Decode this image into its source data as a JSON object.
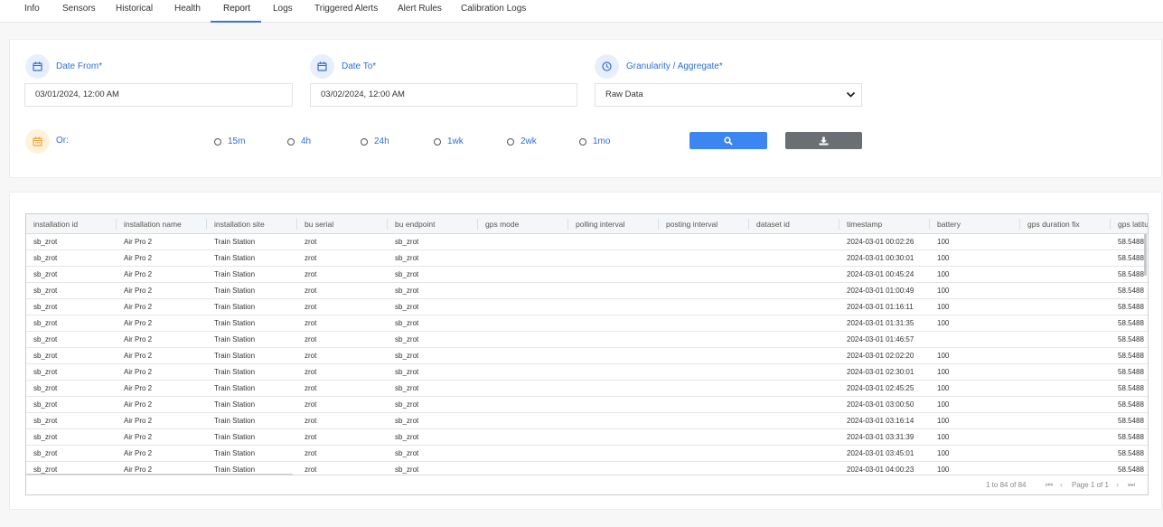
{
  "tabs": [
    "Info",
    "Sensors",
    "Historical",
    "Health",
    "Report",
    "Logs",
    "Triggered Alerts",
    "Alert Rules",
    "Calibration Logs"
  ],
  "active_tab": "Report",
  "filters": {
    "date_from_label": "Date From*",
    "date_from_value": "03/01/2024, 12:00 AM",
    "date_to_label": "Date To*",
    "date_to_value": "03/02/2024, 12:00 AM",
    "granularity_label": "Granularity / Aggregate*",
    "granularity_value": "Raw Data",
    "or_label": "Or:",
    "quick_ranges": [
      "15m",
      "4h",
      "24h",
      "1wk",
      "2wk",
      "1mo"
    ]
  },
  "icons": {
    "date_from": "calendar-icon",
    "date_to": "calendar-icon",
    "granularity": "clock-icon",
    "or": "calendar-icon",
    "search": "search-icon",
    "download": "download-icon"
  },
  "colors": {
    "accent": "#3b86f0",
    "link": "#2f6fd6",
    "gray_button": "#6b6f73",
    "or_icon_bg": "#fff2db"
  },
  "table": {
    "columns": [
      "installation id",
      "installation name",
      "installation site",
      "bu serial",
      "bu endpoint",
      "gps mode",
      "polling interval",
      "posting interval",
      "dataset id",
      "timestamp",
      "battery",
      "gps duration fix",
      "gps latitu"
    ],
    "rows": [
      [
        "sb_zrot",
        "Air Pro 2",
        "Train Station",
        "zrot",
        "sb_zrot",
        "",
        "",
        "",
        "",
        "2024-03-01 00:02:26",
        "100",
        "",
        "58.5488"
      ],
      [
        "sb_zrot",
        "Air Pro 2",
        "Train Station",
        "zrot",
        "sb_zrot",
        "",
        "",
        "",
        "",
        "2024-03-01 00:30:01",
        "100",
        "",
        "58.5488"
      ],
      [
        "sb_zrot",
        "Air Pro 2",
        "Train Station",
        "zrot",
        "sb_zrot",
        "",
        "",
        "",
        "",
        "2024-03-01 00:45:24",
        "100",
        "",
        "58.5488"
      ],
      [
        "sb_zrot",
        "Air Pro 2",
        "Train Station",
        "zrot",
        "sb_zrot",
        "",
        "",
        "",
        "",
        "2024-03-01 01:00:49",
        "100",
        "",
        "58.5488"
      ],
      [
        "sb_zrot",
        "Air Pro 2",
        "Train Station",
        "zrot",
        "sb_zrot",
        "",
        "",
        "",
        "",
        "2024-03-01 01:16:11",
        "100",
        "",
        "58.5488"
      ],
      [
        "sb_zrot",
        "Air Pro 2",
        "Train Station",
        "zrot",
        "sb_zrot",
        "",
        "",
        "",
        "",
        "2024-03-01 01:31:35",
        "100",
        "",
        "58.5488"
      ],
      [
        "sb_zrot",
        "Air Pro 2",
        "Train Station",
        "zrot",
        "sb_zrot",
        "",
        "",
        "",
        "",
        "2024-03-01 01:46:57",
        "",
        "",
        "58.5488"
      ],
      [
        "sb_zrot",
        "Air Pro 2",
        "Train Station",
        "zrot",
        "sb_zrot",
        "",
        "",
        "",
        "",
        "2024-03-01 02:02:20",
        "100",
        "",
        "58.5488"
      ],
      [
        "sb_zrot",
        "Air Pro 2",
        "Train Station",
        "zrot",
        "sb_zrot",
        "",
        "",
        "",
        "",
        "2024-03-01 02:30:01",
        "100",
        "",
        "58.5488"
      ],
      [
        "sb_zrot",
        "Air Pro 2",
        "Train Station",
        "zrot",
        "sb_zrot",
        "",
        "",
        "",
        "",
        "2024-03-01 02:45:25",
        "100",
        "",
        "58.5488"
      ],
      [
        "sb_zrot",
        "Air Pro 2",
        "Train Station",
        "zrot",
        "sb_zrot",
        "",
        "",
        "",
        "",
        "2024-03-01 03:00:50",
        "100",
        "",
        "58.5488"
      ],
      [
        "sb_zrot",
        "Air Pro 2",
        "Train Station",
        "zrot",
        "sb_zrot",
        "",
        "",
        "",
        "",
        "2024-03-01 03:16:14",
        "100",
        "",
        "58.5488"
      ],
      [
        "sb_zrot",
        "Air Pro 2",
        "Train Station",
        "zrot",
        "sb_zrot",
        "",
        "",
        "",
        "",
        "2024-03-01 03:31:39",
        "100",
        "",
        "58.5488"
      ],
      [
        "sb_zrot",
        "Air Pro 2",
        "Train Station",
        "zrot",
        "sb_zrot",
        "",
        "",
        "",
        "",
        "2024-03-01 03:45:01",
        "100",
        "",
        "58.5488"
      ],
      [
        "sb_zrot",
        "Air Pro 2",
        "Train Station",
        "zrot",
        "sb_zrot",
        "",
        "",
        "",
        "",
        "2024-03-01 04:00:23",
        "100",
        "",
        "58.5488"
      ]
    ],
    "footer": {
      "range_text": "1 to 84 of 84",
      "page_text": "Page 1 of 1"
    }
  }
}
